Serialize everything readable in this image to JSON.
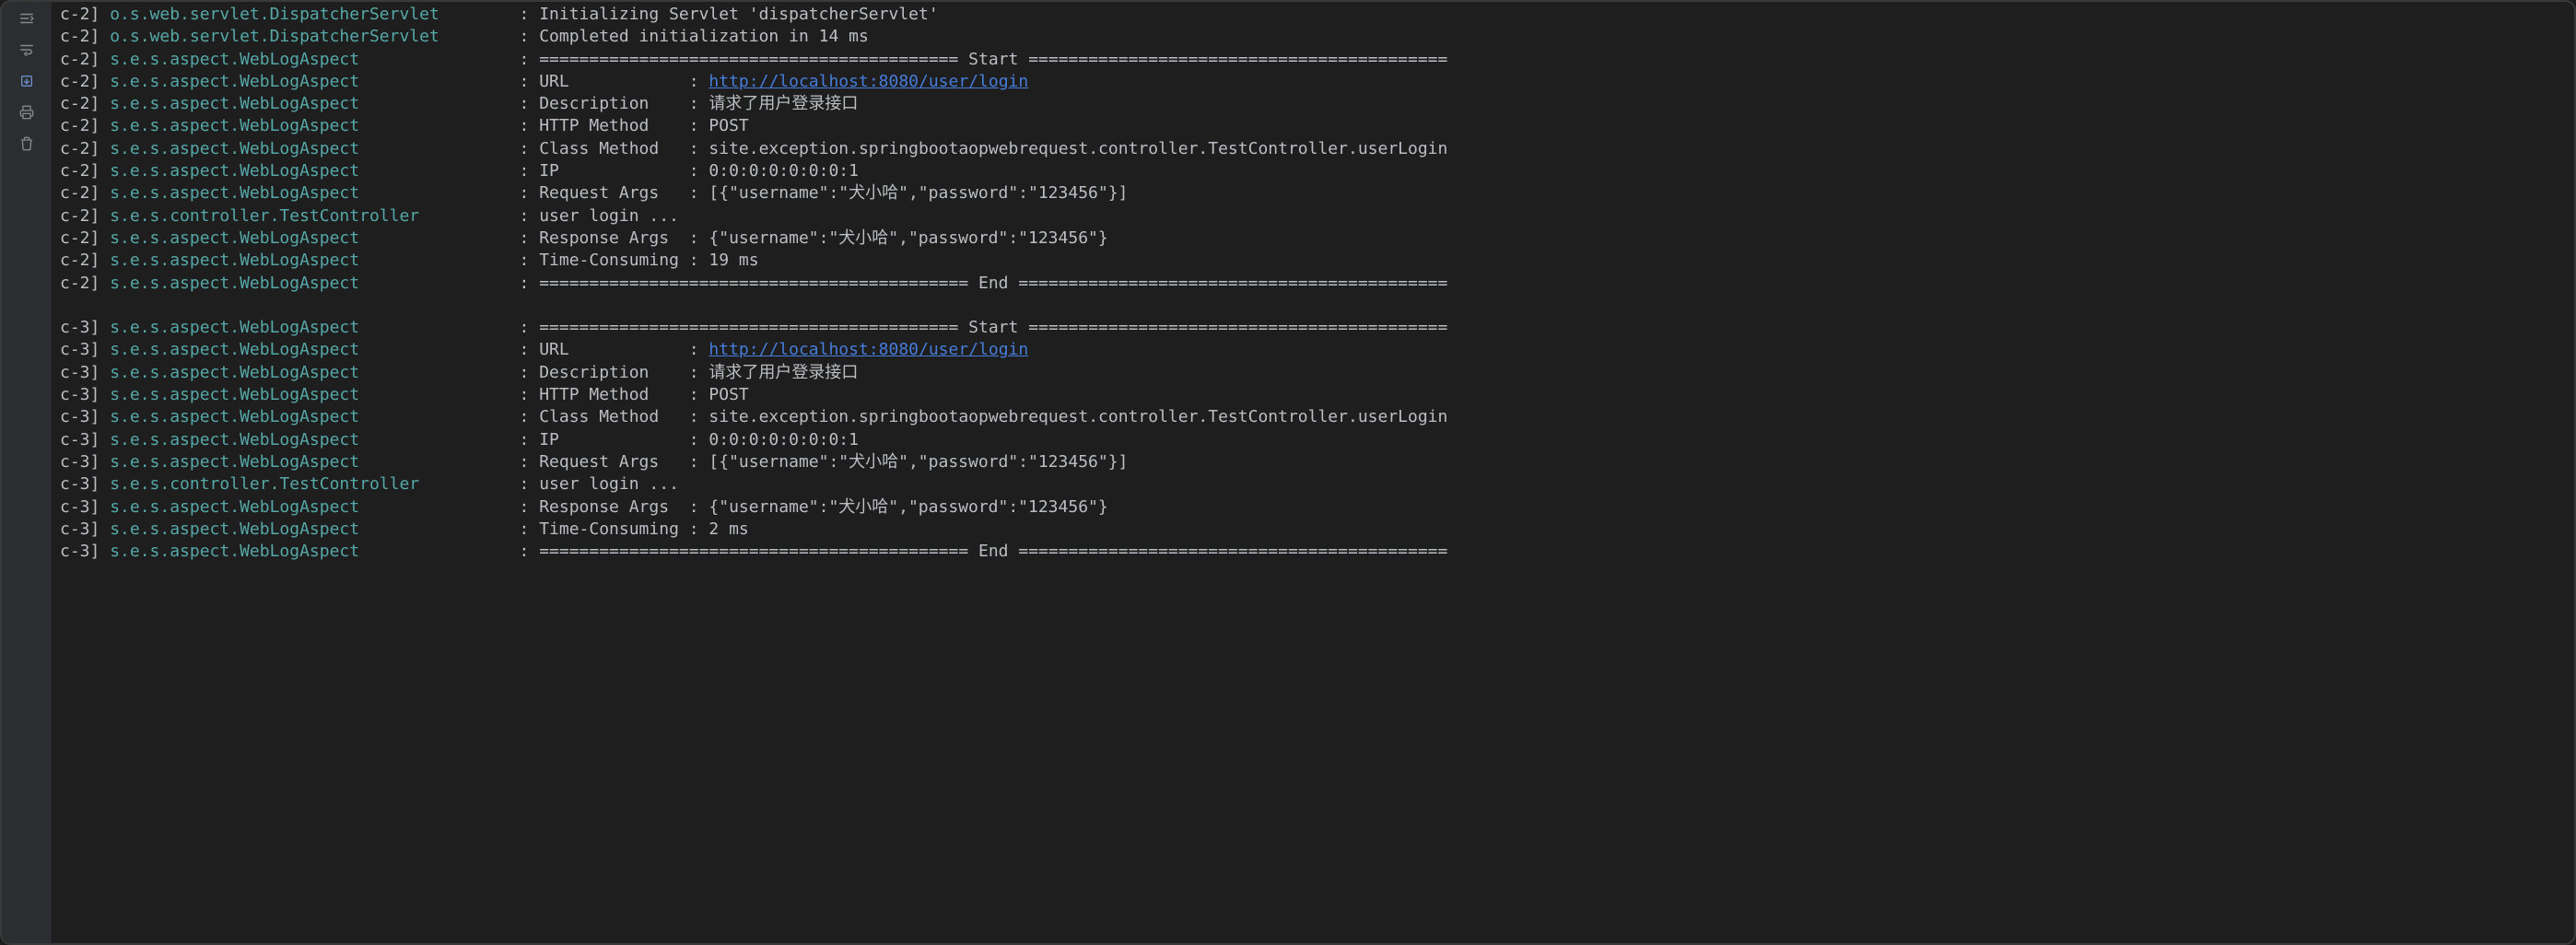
{
  "icons": {
    "toggle": "toggle-icon",
    "wrap": "wrap-icon",
    "export": "export-icon",
    "print": "print-icon",
    "trash": "trash-icon"
  },
  "log": {
    "thread_prefix_2": "c-2]",
    "thread_prefix_3": "c-3]",
    "logger_dispatcher": "o.s.web.servlet.DispatcherServlet       ",
    "logger_weblog": "s.e.s.aspect.WebLogAspect               ",
    "logger_controller": "s.e.s.controller.TestController         ",
    "sep": " : ",
    "lines": [
      {
        "t": "2",
        "lg": "dispatcher",
        "msg": "Initializing Servlet 'dispatcherServlet'"
      },
      {
        "t": "2",
        "lg": "dispatcher",
        "msg": "Completed initialization in 14 ms"
      },
      {
        "t": "2",
        "lg": "weblog",
        "msg": "========================================== Start =========================================="
      },
      {
        "t": "2",
        "lg": "weblog",
        "label": "URL            : ",
        "link": "http://localhost:8080/user/login"
      },
      {
        "t": "2",
        "lg": "weblog",
        "msg": "Description    : 请求了用户登录接口"
      },
      {
        "t": "2",
        "lg": "weblog",
        "msg": "HTTP Method    : POST"
      },
      {
        "t": "2",
        "lg": "weblog",
        "msg": "Class Method   : site.exception.springbootaopwebrequest.controller.TestController.userLogin"
      },
      {
        "t": "2",
        "lg": "weblog",
        "msg": "IP             : 0:0:0:0:0:0:0:1"
      },
      {
        "t": "2",
        "lg": "weblog",
        "msg": "Request Args   : [{\"username\":\"犬小哈\",\"password\":\"123456\"}]"
      },
      {
        "t": "2",
        "lg": "controller",
        "msg": "user login ..."
      },
      {
        "t": "2",
        "lg": "weblog",
        "msg": "Response Args  : {\"username\":\"犬小哈\",\"password\":\"123456\"}"
      },
      {
        "t": "2",
        "lg": "weblog",
        "msg": "Time-Consuming : 19 ms"
      },
      {
        "t": "2",
        "lg": "weblog",
        "msg": "=========================================== End ==========================================="
      },
      {
        "blank": true
      },
      {
        "t": "3",
        "lg": "weblog",
        "msg": "========================================== Start =========================================="
      },
      {
        "t": "3",
        "lg": "weblog",
        "label": "URL            : ",
        "link": "http://localhost:8080/user/login"
      },
      {
        "t": "3",
        "lg": "weblog",
        "msg": "Description    : 请求了用户登录接口"
      },
      {
        "t": "3",
        "lg": "weblog",
        "msg": "HTTP Method    : POST"
      },
      {
        "t": "3",
        "lg": "weblog",
        "msg": "Class Method   : site.exception.springbootaopwebrequest.controller.TestController.userLogin"
      },
      {
        "t": "3",
        "lg": "weblog",
        "msg": "IP             : 0:0:0:0:0:0:0:1"
      },
      {
        "t": "3",
        "lg": "weblog",
        "msg": "Request Args   : [{\"username\":\"犬小哈\",\"password\":\"123456\"}]"
      },
      {
        "t": "3",
        "lg": "controller",
        "msg": "user login ..."
      },
      {
        "t": "3",
        "lg": "weblog",
        "msg": "Response Args  : {\"username\":\"犬小哈\",\"password\":\"123456\"}"
      },
      {
        "t": "3",
        "lg": "weblog",
        "msg": "Time-Consuming : 2 ms"
      },
      {
        "t": "3",
        "lg": "weblog",
        "msg": "=========================================== End ==========================================="
      }
    ]
  }
}
